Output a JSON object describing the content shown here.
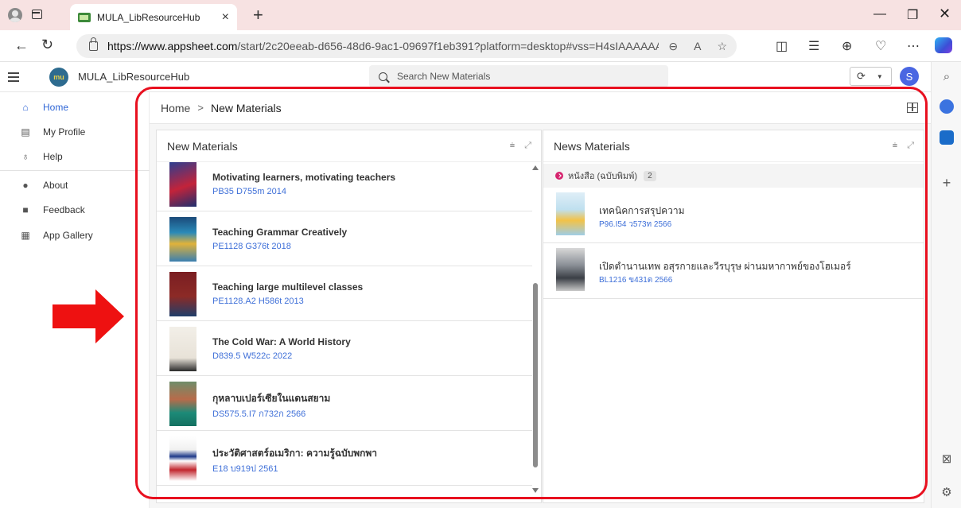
{
  "browser": {
    "tab_title": "MULA_LibResourceHub",
    "url_domain": "https://www.appsheet.com",
    "url_path": "/start/2c20eeab-d656-48d6-9ac1-09697f1eb391?platform=desktop#vss=H4sIAAAAAAAAA..."
  },
  "app": {
    "name": "MULA_LibResourceHub",
    "logo_text": "mu",
    "search_placeholder": "Search New Materials",
    "avatar_letter": "S"
  },
  "nav": [
    {
      "label": "Home",
      "icon": "home-icon"
    },
    {
      "label": "My Profile",
      "icon": "profile-card-icon"
    },
    {
      "label": "Help",
      "icon": "lightbulb-icon"
    },
    {
      "label": "About",
      "icon": "info-icon"
    },
    {
      "label": "Feedback",
      "icon": "feedback-icon"
    },
    {
      "label": "App Gallery",
      "icon": "grid-icon"
    }
  ],
  "breadcrumb": {
    "root": "Home",
    "separator": ">",
    "current": "New Materials"
  },
  "left_panel": {
    "title": "New Materials",
    "items": [
      {
        "title": "Motivating learners, motivating teachers",
        "call_number": "PB35 D755m 2014"
      },
      {
        "title": "Teaching Grammar Creatively",
        "call_number": "PE1128 G376t 2018"
      },
      {
        "title": "Teaching large multilevel classes",
        "call_number": "PE1128.A2 H586t 2013"
      },
      {
        "title": "The Cold War: A World History",
        "call_number": "D839.5 W522c 2022"
      },
      {
        "title": "กุหลาบเปอร์เซียในแดนสยาม",
        "call_number": "DS575.5.I7 ก732ก 2566"
      },
      {
        "title": "ประวัติศาสตร์อเมริกา: ความรู้ฉบับพกพา",
        "call_number": "E18 บ919ป 2561"
      }
    ]
  },
  "right_panel": {
    "title": "News Materials",
    "group_label": "หนังสือ (ฉบับพิมพ์)",
    "group_count": "2",
    "items": [
      {
        "title": "เทคนิคการสรุปความ",
        "call_number": "P96.I54 ว573ท 2566"
      },
      {
        "title": "เปิดตำนานเทพ อสุรกายและวีรบุรุษ ผ่านมหากาพย์ของโฮเมอร์",
        "call_number": "BL1216 ข431ต 2566"
      }
    ]
  },
  "colors": {
    "accent": "#2f66d6",
    "link": "#3e6fd8",
    "annotation": "#e8101f"
  }
}
